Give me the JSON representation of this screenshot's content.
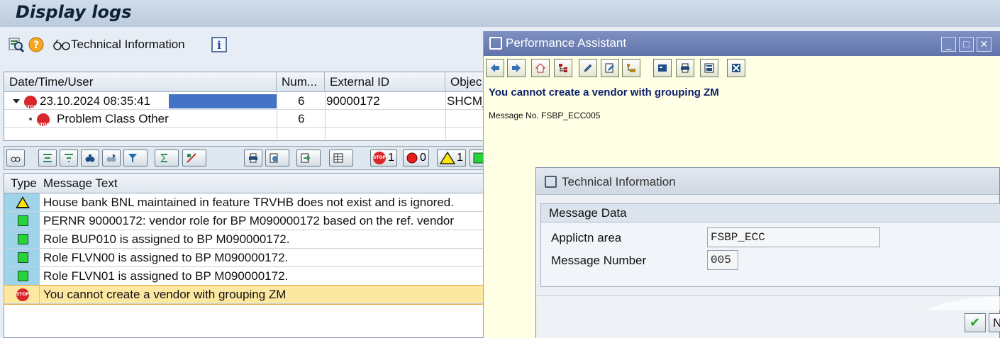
{
  "page": {
    "title": "Display logs"
  },
  "toolbar": {
    "technical_info_label": "Technical Information"
  },
  "log_tree": {
    "columns": [
      "Date/Time/User",
      "Num...",
      "External ID",
      "Objec"
    ],
    "rows": [
      {
        "datetime": "23.10.2024  08:35:41",
        "num": "6",
        "external_id": "90000172",
        "object": "SHCM_"
      },
      {
        "label": "Problem Class Other",
        "num": "6"
      }
    ]
  },
  "alv": {
    "counts": {
      "error": "1",
      "stop": "0",
      "warning": "1"
    }
  },
  "messages": {
    "columns": [
      "Type",
      "Message Text"
    ],
    "rows": [
      {
        "type": "warning",
        "text": "House bank BNL maintained in feature TRVHB does not exist and is ignored."
      },
      {
        "type": "success",
        "text": "PERNR 90000172: vendor role for BP M090000172 based on the ref. vendor"
      },
      {
        "type": "success",
        "text": "Role BUP010 is assigned to BP M090000172."
      },
      {
        "type": "success",
        "text": "Role FLVN00 is assigned to BP M090000172."
      },
      {
        "type": "success",
        "text": "Role FLVN01 is assigned to BP M090000172."
      },
      {
        "type": "error",
        "text": "You cannot create a vendor with grouping ZM"
      }
    ]
  },
  "performance_assistant": {
    "title": "Performance Assistant",
    "message": "You cannot create a vendor with grouping ZM",
    "message_no": "Message No. FSBP_ECC005"
  },
  "tech_info": {
    "title": "Technical Information",
    "group_title": "Message Data",
    "applictn_area_label": "Applictn area",
    "applictn_area_value": "FSBP_ECC",
    "message_number_label": "Message Number",
    "message_number_value": "005",
    "next_button_label": "N"
  },
  "colors": {
    "accent": "#6173ab",
    "selected_row": "#fde8a2",
    "type_cell": "#9fd3ea"
  }
}
